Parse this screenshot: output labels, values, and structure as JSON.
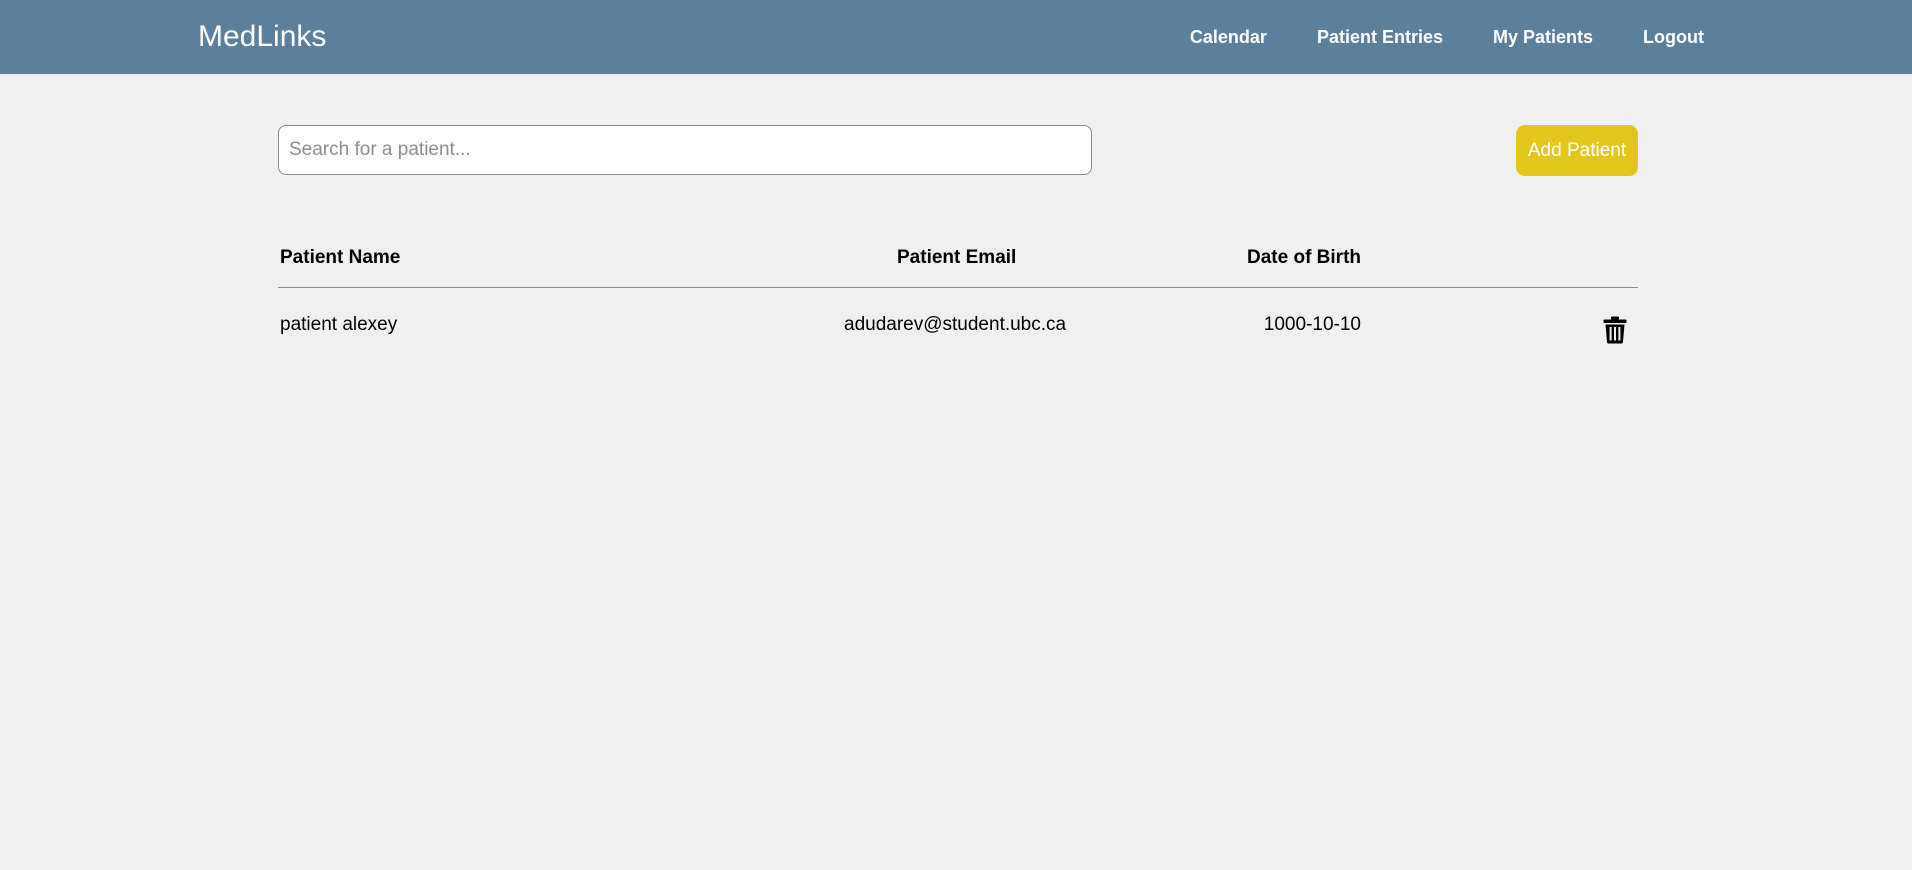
{
  "navbar": {
    "brand": "MedLinks",
    "links": [
      {
        "label": "Calendar"
      },
      {
        "label": "Patient Entries"
      },
      {
        "label": "My Patients"
      },
      {
        "label": "Logout"
      }
    ],
    "background_color": "#5b809b"
  },
  "search": {
    "placeholder": "Search for a patient...",
    "value": ""
  },
  "add_patient_button": {
    "label": "Add Patient",
    "color": "#e3c51c"
  },
  "table": {
    "columns": [
      "Patient Name",
      "Patient Email",
      "Date of Birth"
    ],
    "rows": [
      {
        "name": "patient alexey",
        "email": "adudarev@student.ubc.ca",
        "dob": "1000-10-10",
        "action_icon": "trash-icon"
      }
    ]
  }
}
